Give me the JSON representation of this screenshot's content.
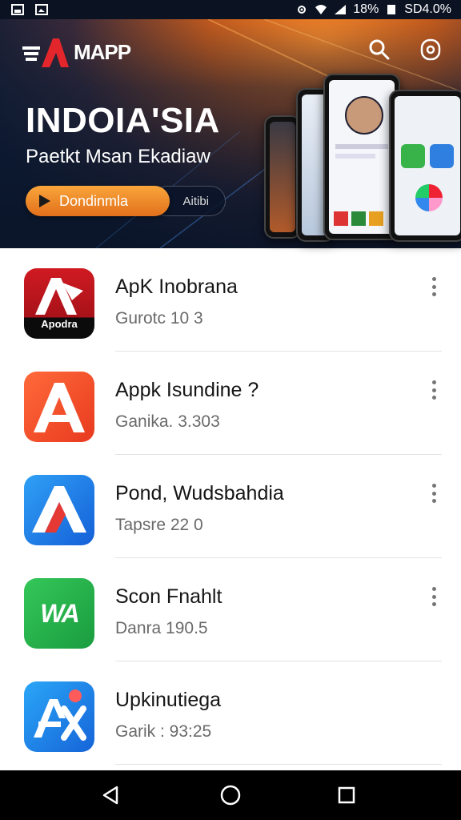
{
  "status_bar": {
    "battery_text": "18%",
    "network_text": "SD4.0%"
  },
  "header": {
    "logo_text": "MAPP",
    "icons": [
      "search-icon",
      "profile-icon"
    ]
  },
  "banner": {
    "title": "INDOIA'SIA",
    "subtitle": "Paetkt Msan Ekadiaw",
    "cta_label": "Dondinmla",
    "secondary_label": "Aitibi"
  },
  "apps": [
    {
      "name": "ApK Inobrana",
      "meta": "Gurotc 10 3",
      "icon_text": "Apodra",
      "color": "#c0161d"
    },
    {
      "name": "Appk Isundine ?",
      "meta": "Ganika. 3.303",
      "icon_text": "A",
      "color": "#f24a2a"
    },
    {
      "name": "Pond, Wudsbahdia",
      "meta": "Tapsre 22 0",
      "icon_text": "A",
      "color": "#1b73e8"
    },
    {
      "name": "Scon Fnahlt",
      "meta": "Danra 190.5",
      "icon_text": "WA",
      "color": "#1fa745"
    },
    {
      "name": "Upkinutiega",
      "meta": "Garik : 93:25",
      "icon_text": "AX",
      "color": "#1a7fe6"
    }
  ],
  "nav": {
    "icons": [
      "back-icon",
      "home-icon",
      "recents-icon"
    ]
  },
  "colors": {
    "accent": "#f28c28",
    "header_dark": "#0d1b33"
  }
}
